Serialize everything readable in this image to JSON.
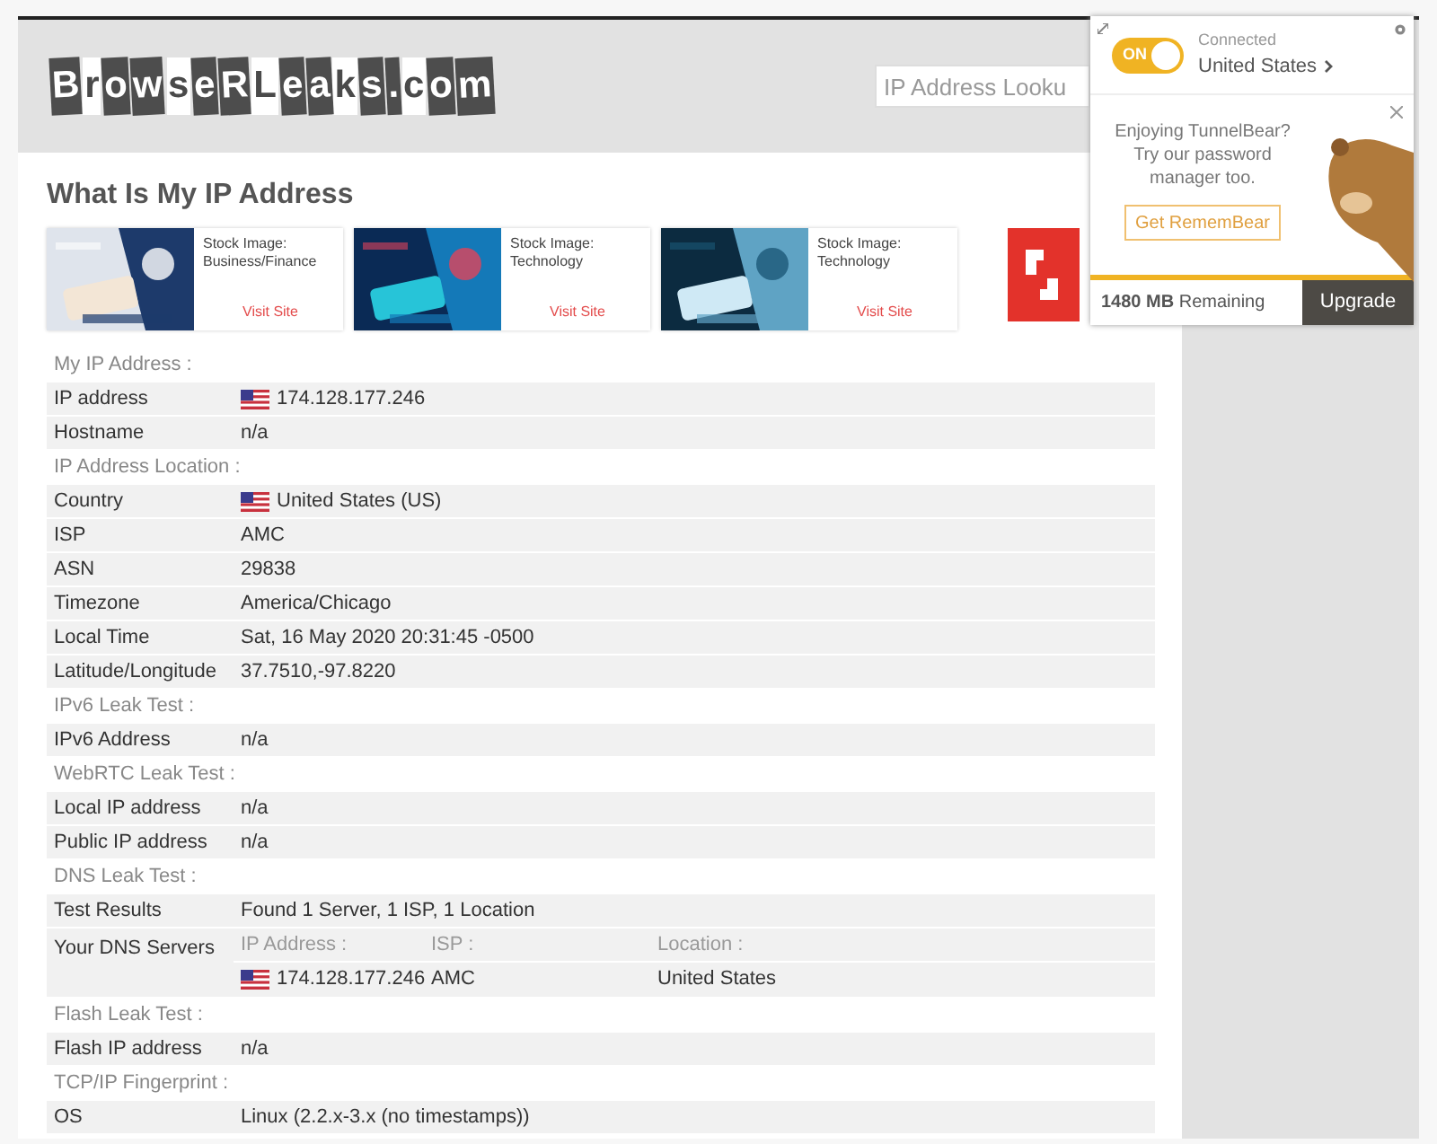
{
  "header": {
    "logo": "BrowseRLeaks.com",
    "search": {
      "placeholder": "IP Address Looku"
    }
  },
  "page_title": "What Is My IP Address",
  "ads": [
    {
      "title": "Stock Image: Business/Finance",
      "link": "Visit Site"
    },
    {
      "title": "Stock Image: Technology",
      "link": "Visit Site"
    },
    {
      "title": "Stock Image: Technology",
      "link": "Visit Site"
    },
    {
      "kind": "picture"
    }
  ],
  "sections": [
    {
      "title": "My IP Address :",
      "rows": [
        {
          "kind": "plain",
          "label": "IP address",
          "value": "174.128.177.246",
          "flag": true
        },
        {
          "kind": "plain",
          "label": "Hostname",
          "value": "n/a",
          "flag": false
        }
      ]
    },
    {
      "title": "IP Address Location :",
      "rows": [
        {
          "kind": "plain",
          "label": "Country",
          "value": "United States (US)",
          "flag": true
        },
        {
          "kind": "plain",
          "label": "ISP",
          "value": "AMC",
          "flag": false
        },
        {
          "kind": "plain",
          "label": "ASN",
          "value": "29838",
          "flag": false
        },
        {
          "kind": "plain",
          "label": "Timezone",
          "value": "America/Chicago",
          "flag": false
        },
        {
          "kind": "plain",
          "label": "Local Time",
          "value": "Sat, 16 May 2020 20:31:45 -0500",
          "flag": false
        },
        {
          "kind": "plain",
          "label": "Latitude/Longitude",
          "value": "37.7510,-97.8220",
          "flag": false
        }
      ]
    },
    {
      "title": "IPv6 Leak Test :",
      "rows": [
        {
          "kind": "plain",
          "label": "IPv6 Address",
          "value": "n/a",
          "flag": false
        }
      ]
    },
    {
      "title": "WebRTC Leak Test :",
      "rows": [
        {
          "kind": "plain",
          "label": "Local IP address",
          "value": "n/a",
          "flag": false
        },
        {
          "kind": "plain",
          "label": "Public IP address",
          "value": "n/a",
          "flag": false
        }
      ]
    },
    {
      "title": "DNS Leak Test :",
      "rows": [
        {
          "kind": "plain",
          "label": "Test Results",
          "value": "Found 1 Server, 1 ISP, 1 Location",
          "flag": false
        },
        {
          "kind": "servers",
          "label": "Your DNS Servers",
          "columns": [
            "IP Address :",
            "ISP :",
            "Location :"
          ],
          "servers": [
            {
              "ip": "174.128.177.246",
              "isp": "AMC",
              "location": "United States",
              "flag": true
            }
          ]
        }
      ]
    },
    {
      "title": "Flash Leak Test :",
      "rows": [
        {
          "kind": "plain",
          "label": "Flash IP address",
          "value": "n/a",
          "flag": false
        }
      ]
    },
    {
      "title": "TCP/IP Fingerprint :",
      "rows": [
        {
          "kind": "plain",
          "label": "OS",
          "value": "Linux (2.2.x-3.x (no timestamps))",
          "flag": false
        }
      ]
    }
  ],
  "vpn_popup": {
    "toggle": {
      "label": "ON",
      "on": true
    },
    "status": "Connected",
    "location": "United States",
    "promo": "Enjoying TunnelBear? Try our password manager too.",
    "promo_button": "Get RememBear",
    "remaining": "**1480 MB** Remaining",
    "upgrade": "Upgrade"
  }
}
